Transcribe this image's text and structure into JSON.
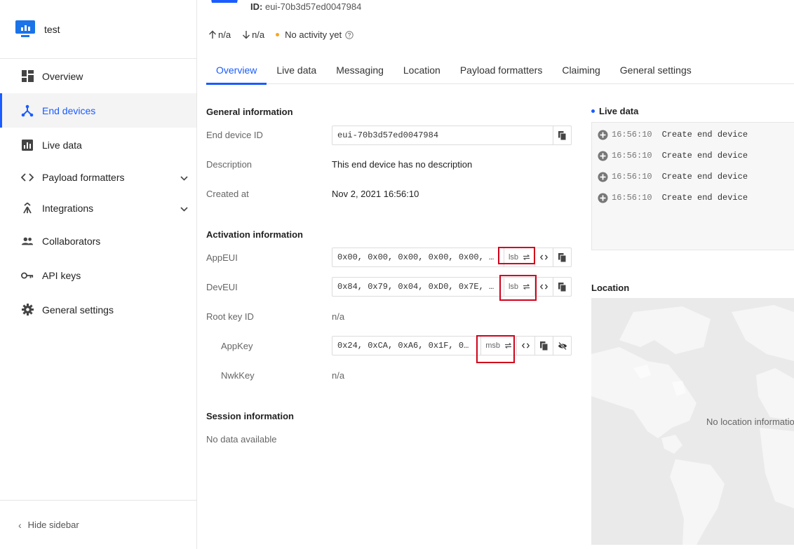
{
  "app": {
    "name": "test"
  },
  "sidebar": {
    "items": [
      {
        "label": "Overview",
        "icon": "dashboard-icon"
      },
      {
        "label": "End devices",
        "icon": "end-devices-icon",
        "active": true
      },
      {
        "label": "Live data",
        "icon": "live-data-icon"
      },
      {
        "label": "Payload formatters",
        "icon": "code-icon",
        "expandable": true
      },
      {
        "label": "Integrations",
        "icon": "integrations-icon",
        "expandable": true
      },
      {
        "label": "Collaborators",
        "icon": "people-icon"
      },
      {
        "label": "API keys",
        "icon": "key-icon"
      },
      {
        "label": "General settings",
        "icon": "gear-icon"
      }
    ],
    "hide_label": "Hide sidebar"
  },
  "header": {
    "id_label": "ID:",
    "id_value": "eui-70b3d57ed0047984",
    "uplink": "n/a",
    "downlink": "n/a",
    "activity": "No activity yet"
  },
  "tabs": [
    "Overview",
    "Live data",
    "Messaging",
    "Location",
    "Payload formatters",
    "Claiming",
    "General settings"
  ],
  "general": {
    "title": "General information",
    "device_id_label": "End device ID",
    "device_id_value": "eui-70b3d57ed0047984",
    "description_label": "Description",
    "description_value": "This end device has no description",
    "created_label": "Created at",
    "created_value": "Nov 2, 2021 16:56:10"
  },
  "activation": {
    "title": "Activation information",
    "appeui_label": "AppEUI",
    "appeui_value": "0x00, 0x00, 0x00, 0x00, 0x00, …",
    "appeui_order": "lsb",
    "deveui_label": "DevEUI",
    "deveui_value": "0x84, 0x79, 0x04, 0xD0, 0x7E, …",
    "deveui_order": "lsb",
    "rootkey_label": "Root key ID",
    "rootkey_value": "n/a",
    "appkey_label": "AppKey",
    "appkey_value": "0x24, 0xCA, 0xA6, 0x1F, 0…",
    "appkey_order": "msb",
    "nwkkey_label": "NwkKey",
    "nwkkey_value": "n/a"
  },
  "session": {
    "title": "Session information",
    "empty": "No data available"
  },
  "live": {
    "title": "Live data",
    "events": [
      {
        "time": "16:56:10",
        "text": "Create end device"
      },
      {
        "time": "16:56:10",
        "text": "Create end device"
      },
      {
        "time": "16:56:10",
        "text": "Create end device"
      },
      {
        "time": "16:56:10",
        "text": "Create end device"
      }
    ]
  },
  "location": {
    "title": "Location",
    "empty": "No location information available"
  },
  "colors": {
    "accent": "#1a5cff",
    "highlight": "#d0021b",
    "status_dot": "#f5a623"
  }
}
